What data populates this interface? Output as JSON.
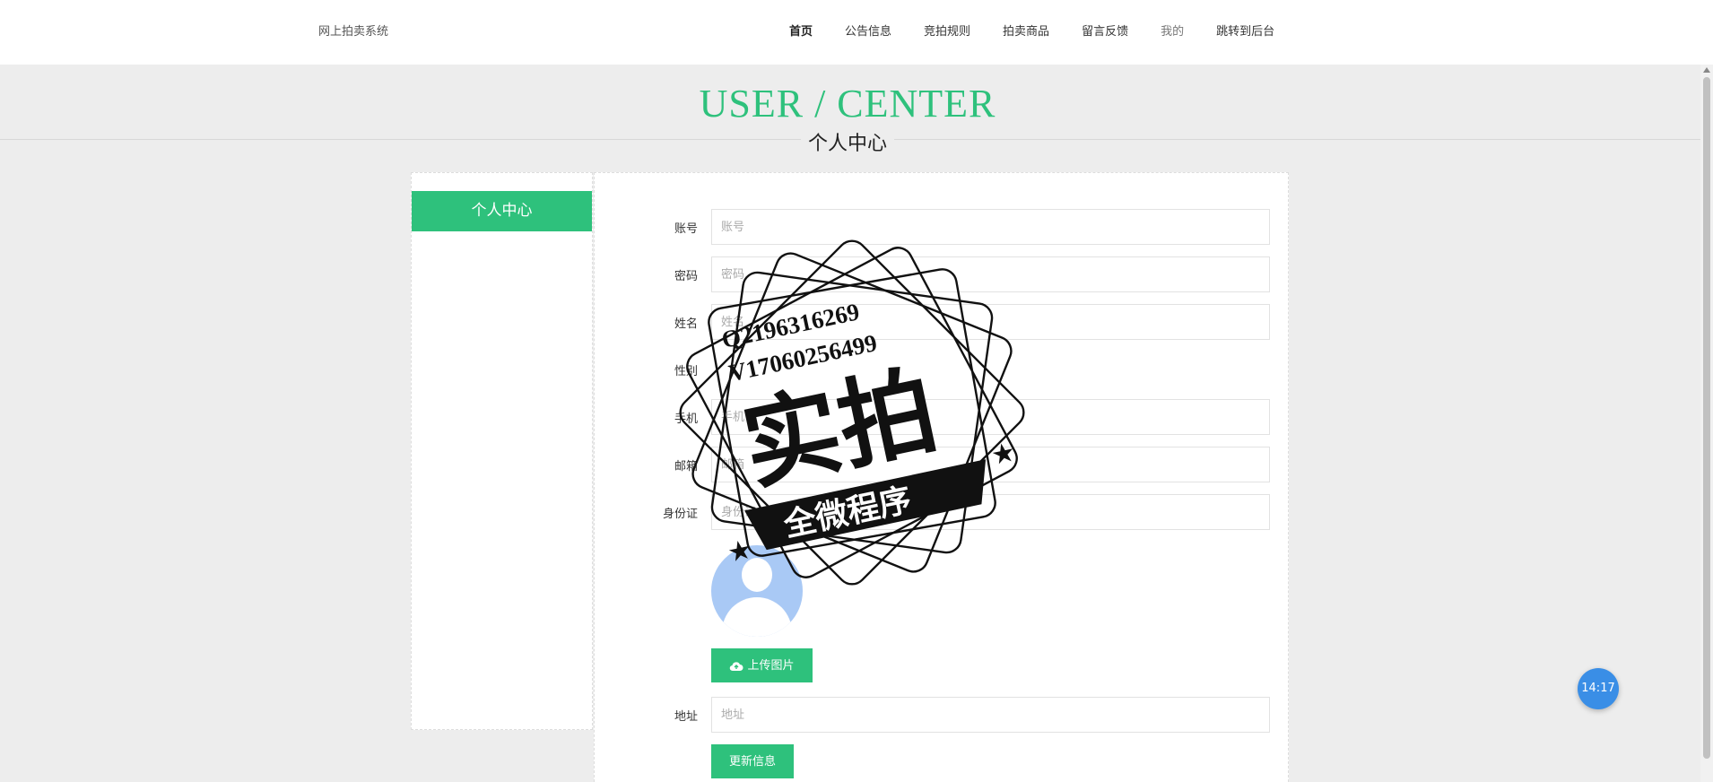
{
  "header": {
    "brand": "网上拍卖系统",
    "nav": [
      {
        "label": "首页"
      },
      {
        "label": "公告信息"
      },
      {
        "label": "竞拍规则"
      },
      {
        "label": "拍卖商品"
      },
      {
        "label": "留言反馈"
      },
      {
        "label": "我的"
      },
      {
        "label": "跳转到后台"
      }
    ]
  },
  "hero": {
    "title": "USER / CENTER",
    "subtitle": "个人中心"
  },
  "sidebar": {
    "items": [
      {
        "label": "个人中心"
      }
    ]
  },
  "form": {
    "fields": [
      {
        "label": "账号",
        "placeholder": "账号",
        "value": ""
      },
      {
        "label": "密码",
        "placeholder": "密码",
        "value": ""
      },
      {
        "label": "姓名",
        "placeholder": "姓名",
        "value": ""
      },
      {
        "label": "性别"
      },
      {
        "label": "手机",
        "placeholder": "手机",
        "value": ""
      },
      {
        "label": "邮箱",
        "placeholder": "邮箱",
        "value": ""
      },
      {
        "label": "身份证",
        "placeholder": "身份证",
        "value": ""
      },
      {
        "label": "地址",
        "placeholder": "地址",
        "value": ""
      }
    ],
    "upload_label": "上传图片",
    "update_label": "更新信息"
  },
  "watermark": {
    "line1": "Q2196316269",
    "line2": "V17060256499",
    "main": "实拍",
    "banner": "全微程序"
  },
  "clock": "14:17",
  "colors": {
    "accent": "#2ec17c",
    "clock": "#3a8ee6"
  }
}
